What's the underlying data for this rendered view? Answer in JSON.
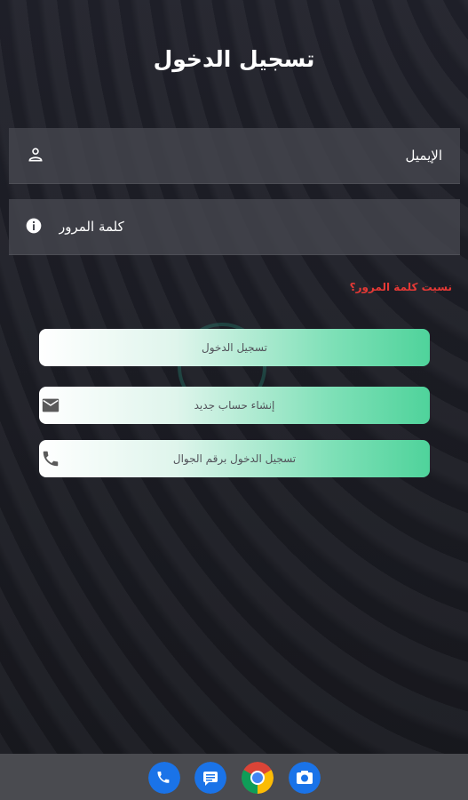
{
  "screen": {
    "title": "تسجيل الدخول"
  },
  "form": {
    "email_placeholder": "الإيميل",
    "password_placeholder": "كلمة المرور",
    "forgot_password": "نسيت كلمة المرور؟"
  },
  "buttons": {
    "login": "تسجيل الدخول",
    "create_account": "إنشاء حساب جديد",
    "phone_login": "تسجيل الدخول برقم الجوال"
  },
  "colors": {
    "background": "#1b1c22",
    "field": "#464850",
    "accent_green": "#4fd39b",
    "link_red": "#e53935",
    "navbar": "#4a4b50"
  },
  "icons": {
    "email_field": "person-icon",
    "password_field": "info-icon",
    "create_account": "mail-icon",
    "phone_login": "phone-icon"
  },
  "dock": [
    "phone-app-icon",
    "messages-app-icon",
    "chrome-app-icon",
    "camera-app-icon"
  ]
}
